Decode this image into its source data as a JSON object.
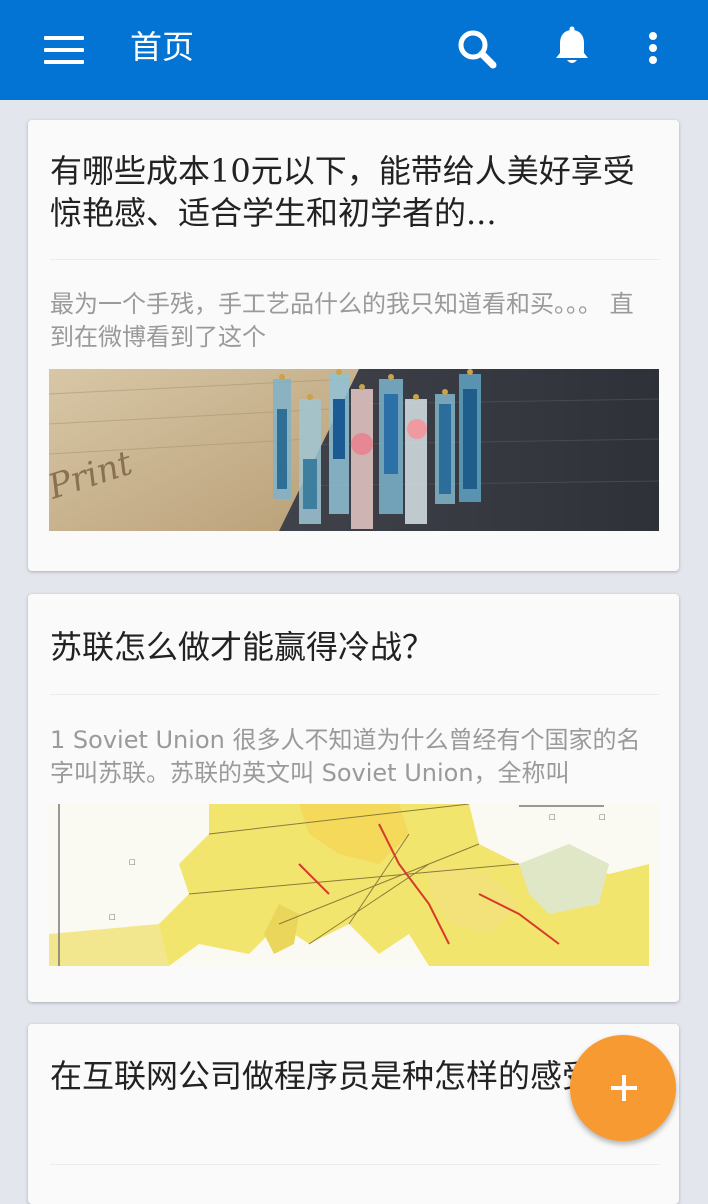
{
  "appbar": {
    "title": "首页",
    "icons": [
      "menu-icon",
      "search-icon",
      "bell-icon",
      "more-vert-icon"
    ],
    "background": "#0474d4"
  },
  "feed": [
    {
      "title": "有哪些成本10元以下，能带给人美好享受惊艳感、适合学生和初学者的...",
      "excerpt": "最为一个手残，手工艺品什么的我只知道看和买。。。 直到在微博看到了这个"
    },
    {
      "title": "苏联怎么做才能赢得冷战？",
      "excerpt": "1 Soviet Union 很多人不知道为什么曾经有个国家的名字叫苏联。苏联的英文叫 Soviet Union，全称叫"
    },
    {
      "title": "在互联网公司做程序员是种怎样的感受？",
      "excerpt": ""
    }
  ],
  "fab": {
    "icon": "plus-icon",
    "color": "#f89a32"
  }
}
